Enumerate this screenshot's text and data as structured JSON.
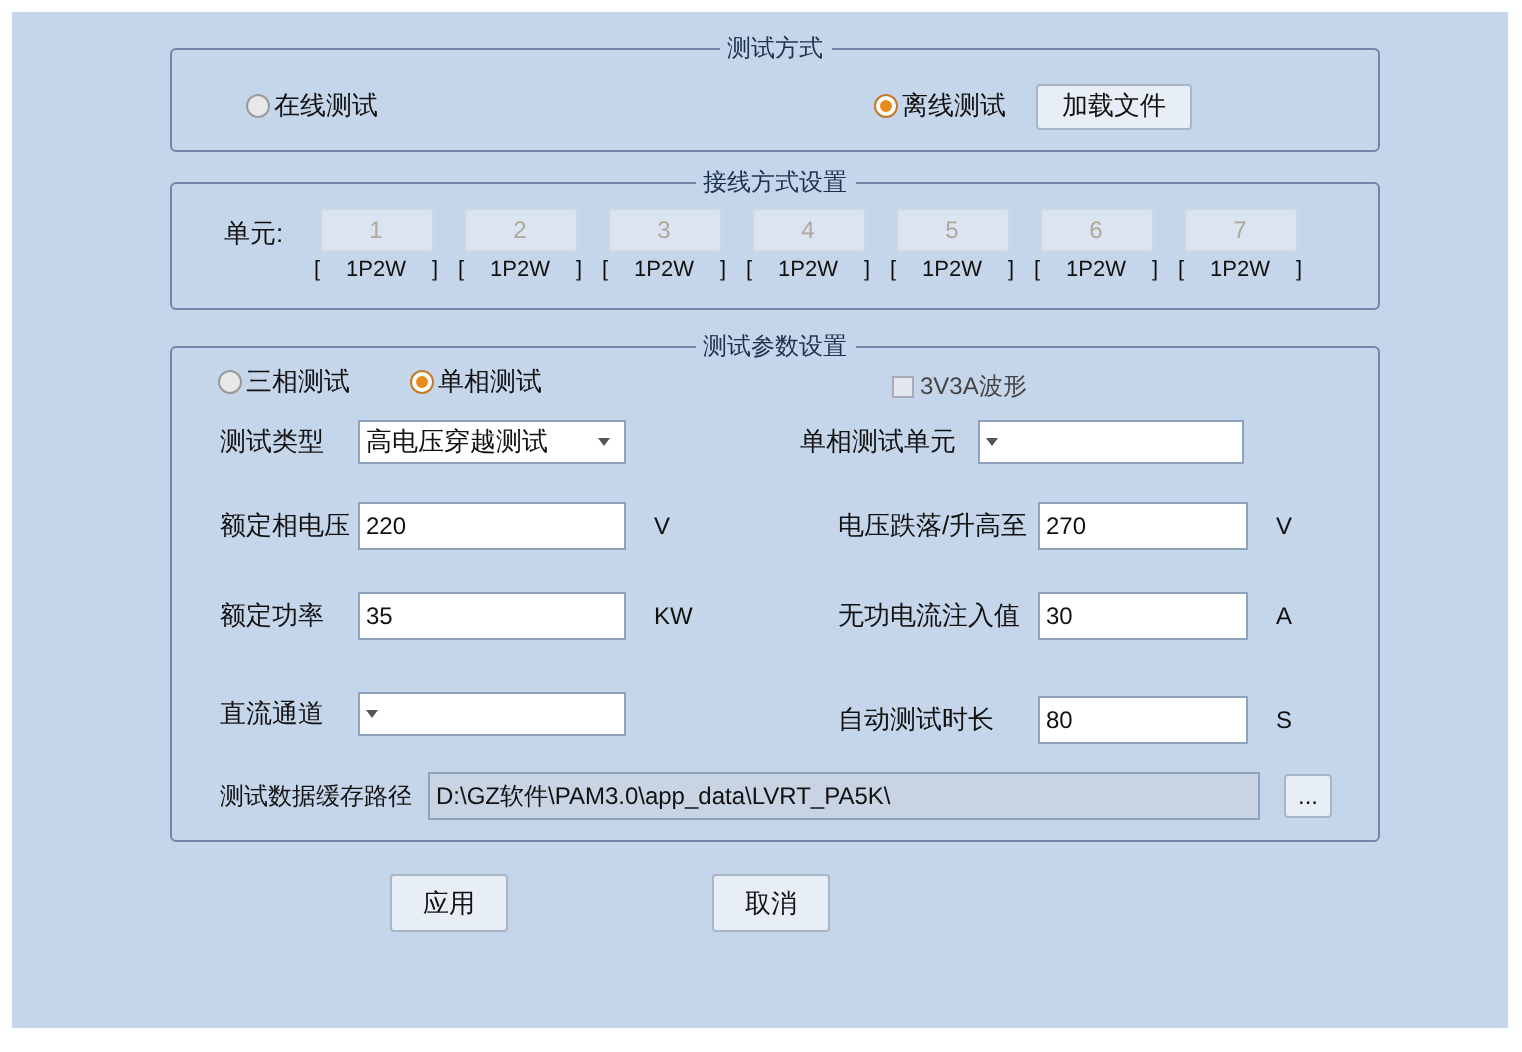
{
  "test_mode": {
    "title": "测试方式",
    "options": [
      {
        "label": "在线测试",
        "selected": false
      },
      {
        "label": "离线测试",
        "selected": true
      }
    ],
    "load_button": "加载文件"
  },
  "wiring": {
    "title": "接线方式设置",
    "unit_label": "单元:",
    "units": [
      {
        "button": "1",
        "disabled": true,
        "open": "[",
        "mode": "1P2W",
        "close": "]"
      },
      {
        "button": "2",
        "disabled": true,
        "open": "[",
        "mode": "1P2W",
        "close": "]"
      },
      {
        "button": "3",
        "disabled": true,
        "open": "[",
        "mode": "1P2W",
        "close": "]"
      },
      {
        "button": "4",
        "disabled": true,
        "open": "[",
        "mode": "1P2W",
        "close": "]"
      },
      {
        "button": "5",
        "disabled": true,
        "open": "[",
        "mode": "1P2W",
        "close": "]"
      },
      {
        "button": "6",
        "disabled": true,
        "open": "[",
        "mode": "1P2W",
        "close": "]"
      },
      {
        "button": "7",
        "disabled": true,
        "open": "[",
        "mode": "1P2W",
        "close": "]"
      }
    ]
  },
  "params": {
    "title": "测试参数设置",
    "phase_options": [
      {
        "label": "三相测试",
        "selected": false
      },
      {
        "label": "单相测试",
        "selected": true
      }
    ],
    "waveform_checkbox": {
      "label": "3V3A波形",
      "checked": false,
      "disabled": true
    },
    "rows": [
      {
        "left": {
          "kind": "dropdown",
          "label": "测试类型",
          "value": "高电压穿越测试"
        },
        "right": {
          "kind": "dropdown",
          "label": "单相测试单元"
        }
      },
      {
        "left": {
          "kind": "input",
          "label": "额定相电压",
          "value": "220",
          "unit": "V"
        },
        "right": {
          "kind": "input",
          "label": "电压跌落/升高至",
          "value": "270",
          "unit": "V"
        }
      },
      {
        "left": {
          "kind": "input",
          "label": "额定功率",
          "value": "35",
          "unit": "KW"
        },
        "right": {
          "kind": "input",
          "label": "无功电流注入值",
          "value": "30",
          "unit": "A"
        }
      },
      {
        "left": {
          "kind": "dropdown",
          "label": "直流通道"
        },
        "right": {
          "kind": "input",
          "label": "自动测试时长",
          "value": "80",
          "unit": "S"
        }
      }
    ],
    "path": {
      "label": "测试数据缓存路径",
      "value": "D:\\GZ软件\\PAM3.0\\app_data\\LVRT_PA5K\\",
      "browse_button": "..."
    }
  },
  "buttons": [
    "应用",
    "取消"
  ]
}
